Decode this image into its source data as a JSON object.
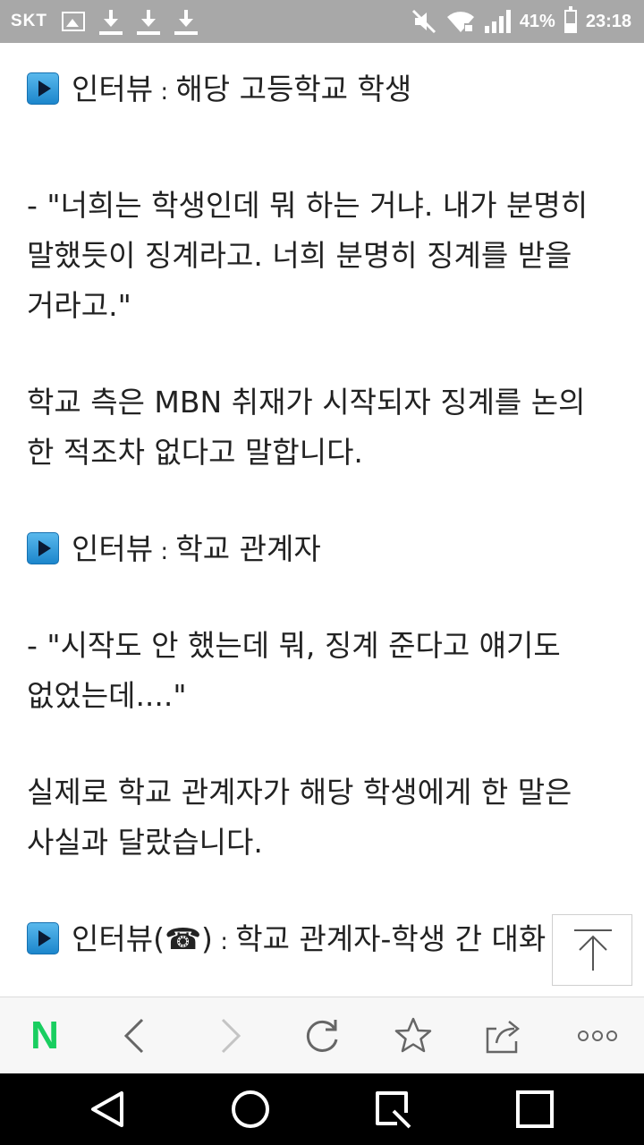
{
  "status_bar": {
    "carrier": "SKT",
    "battery_percent_text": "41%",
    "battery_level": 0.41,
    "time": "23:18",
    "icons": [
      "image-icon",
      "download-icon",
      "download-icon",
      "download-icon",
      "mute-icon",
      "wifi-icon",
      "signal-icon",
      "battery-icon"
    ]
  },
  "article": {
    "lines": [
      {
        "type": "heading",
        "label": "인터뷰",
        "sep": " : ",
        "text": "해당 고등학교 학생"
      },
      {
        "type": "text",
        "text": "- \"너희는 학생인데 뭐 하는 거냐. 내가 분명히"
      },
      {
        "type": "text",
        "text": "말했듯이 징계라고. 너희 분명히 징계를 받을"
      },
      {
        "type": "text",
        "text": "거라고.\""
      },
      {
        "type": "text",
        "text": "학교 측은 MBN 취재가 시작되자 징계를 논의"
      },
      {
        "type": "text",
        "text": "한 적조차 없다고 말합니다."
      },
      {
        "type": "heading",
        "label": "인터뷰",
        "sep": " : ",
        "text": "학교 관계자"
      },
      {
        "type": "text",
        "text": "- \"시작도 안 했는데 뭐, 징계 준다고 얘기도"
      },
      {
        "type": "text",
        "text": "없었는데....\""
      },
      {
        "type": "text",
        "text": "실제로 학교 관계자가 해당 학생에게 한 말은"
      },
      {
        "type": "text",
        "text": "사실과 달랐습니다."
      },
      {
        "type": "heading",
        "label": "인터뷰(☎)",
        "sep": " : ",
        "text": "학교 관계자-학생 간 대화"
      }
    ]
  },
  "scroll_top_button": {
    "icon": "arrow-up-icon"
  },
  "toolbar": {
    "logo": "N",
    "logo_color": "#19ce60",
    "items": [
      "back-icon",
      "forward-icon",
      "refresh-icon",
      "star-icon",
      "share-icon",
      "more-icon"
    ]
  },
  "nav_bar": {
    "items": [
      "back-triangle-icon",
      "home-circle-icon",
      "capture-icon",
      "recents-square-icon"
    ]
  }
}
